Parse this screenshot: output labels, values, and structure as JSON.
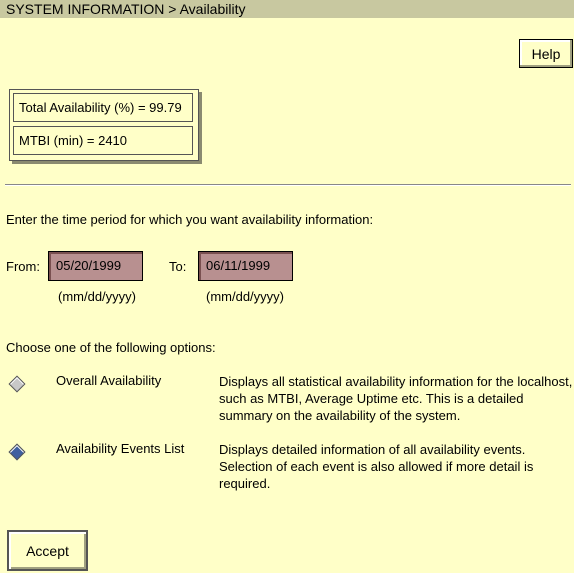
{
  "header": {
    "title": "SYSTEM INFORMATION > Availability"
  },
  "toolbar": {
    "help_label": "Help"
  },
  "summary": {
    "total_availability": "Total Availability (%)  =  99.79",
    "mtbi": "MTBI (min) =  2410"
  },
  "period": {
    "prompt": "Enter the time period for which you want availability information:",
    "from_label": "From:",
    "from_value": "05/20/1999",
    "to_label": "To:",
    "to_value": "06/11/1999",
    "format_hint": "(mm/dd/yyyy)"
  },
  "options": {
    "prompt": "Choose one of the following options:",
    "items": [
      {
        "label": "Overall Availability",
        "description": "Displays all statistical availability information for the localhost, such as MTBI, Average Uptime etc. This is a detailed summary on the availability of the system.",
        "selected": false
      },
      {
        "label": "Availability Events List",
        "description": "Displays detailed information of all availability events. Selection of each event is also allowed if more detail is required.",
        "selected": true
      }
    ]
  },
  "footer": {
    "accept_label": "Accept"
  }
}
